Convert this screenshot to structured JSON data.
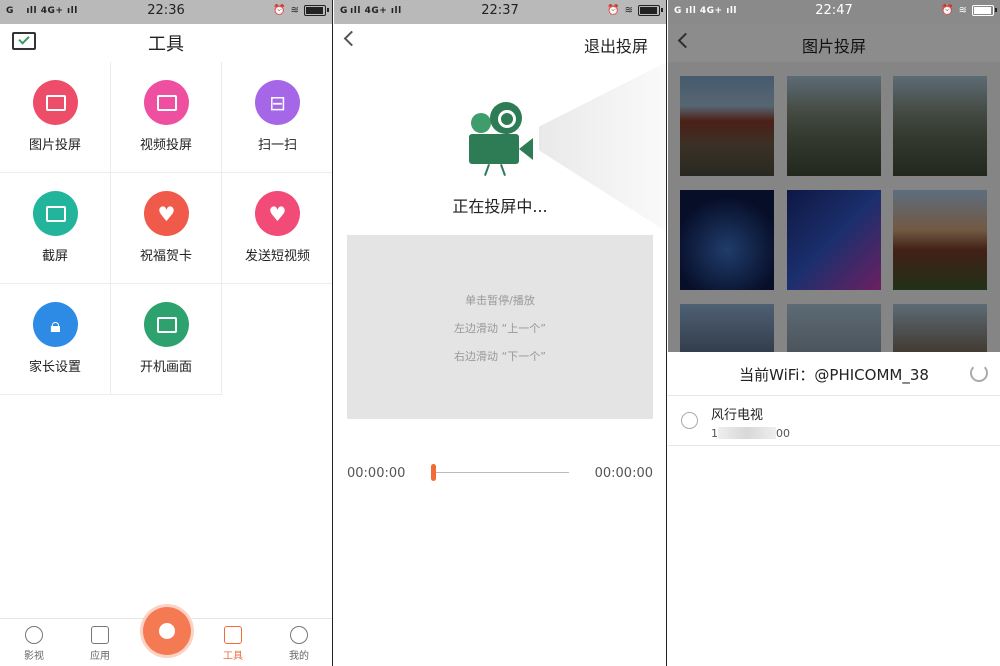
{
  "status_bars": [
    {
      "signal": "G    ıll 4G+ ıll",
      "time": "22:36"
    },
    {
      "signal": "G ıll 4G+ ıll",
      "time": "22:37"
    },
    {
      "signal": "G ıll 4G+ ıll",
      "time": "22:47"
    }
  ],
  "tools": {
    "title": "工具",
    "items": [
      {
        "label": "图片投屏",
        "color": "#ee4d6a"
      },
      {
        "label": "视频投屏",
        "color": "#ee4fa0"
      },
      {
        "label": "扫一扫",
        "color": "#a566e8"
      },
      {
        "label": "截屏",
        "color": "#22b59c"
      },
      {
        "label": "祝福贺卡",
        "color": "#ef5a4b"
      },
      {
        "label": "发送短视频",
        "color": "#f24b78"
      },
      {
        "label": "家长设置",
        "color": "#2d8be6"
      },
      {
        "label": "开机画面",
        "color": "#2ea26e"
      }
    ],
    "tabs": [
      {
        "label": "影视",
        "active": false
      },
      {
        "label": "应用",
        "active": false
      },
      {
        "label": "工具",
        "active": true
      },
      {
        "label": "我的",
        "active": false
      }
    ]
  },
  "casting": {
    "exit_label": "退出投屏",
    "status": "正在投屏中...",
    "hints": [
      "单击暂停/播放",
      "左边滑动 “上一个”",
      "右边滑动 “下一个”"
    ],
    "time_start": "00:00:00",
    "time_end": "00:00:00",
    "progress": 0
  },
  "photo_cast": {
    "title": "图片投屏",
    "wifi_text": "当前WiFi：@PHICOMM_38",
    "device_name": "风行电视",
    "device_ip_prefix": "1",
    "device_ip_suffix": "00"
  }
}
